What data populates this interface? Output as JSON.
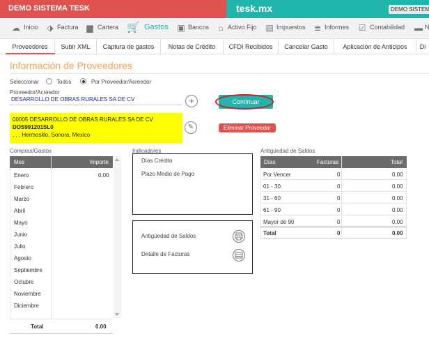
{
  "topbar": {
    "company": "DEMO SISTEMA TESK",
    "brand": "tesk.mx",
    "tag": "DEMO SISTEMA"
  },
  "mainnav": {
    "items": [
      {
        "label": "Inicio",
        "icon": "cloud-icon"
      },
      {
        "label": "Factura",
        "icon": "tag-icon"
      },
      {
        "label": "Cartera",
        "icon": "briefcase-icon"
      },
      {
        "label": "Gastos",
        "icon": "cart-icon"
      },
      {
        "label": "Bancos",
        "icon": "bank-icon"
      },
      {
        "label": "Activo Fijo",
        "icon": "home-icon"
      },
      {
        "label": "Impuestos",
        "icon": "tax-icon"
      },
      {
        "label": "Informes",
        "icon": "report-icon"
      },
      {
        "label": "Contabilidad",
        "icon": "ledger-icon"
      },
      {
        "label": "N",
        "icon": "more-icon"
      }
    ],
    "active_color": "#1fb5ad"
  },
  "subnav": {
    "tabs": [
      "Proveedores",
      "Subir XML",
      "Captura de gastos",
      "Notas de Crédito",
      "CFDI Recibidos",
      "Cancelar Gasto",
      "Aplicación de Anticipos",
      "Di"
    ]
  },
  "page": {
    "title": "Información de Proveedores",
    "select_label": "Seleccionar",
    "radio_todos": "Todos",
    "radio_por": "Por Proveedor/Acreedor",
    "prov_label": "Proveedor/Acreedor",
    "prov_value": "DESARROLLO DE OBRAS RURALES SA DE CV",
    "continuar": "Continuar",
    "eliminar": "Eliminar Proveedor",
    "card": {
      "line1": "00005 DESARROLLO DE OBRAS RURALES SA DE CV",
      "line2": "DOS991201SL0",
      "line3": ", , , Hermosillo, Sonora, Mexico"
    }
  },
  "compras": {
    "section": "Compras/Gastos",
    "col_mes": "Mes",
    "col_importe": "Importe",
    "rows": [
      {
        "mes": "Enero",
        "importe": "0.00"
      },
      {
        "mes": "Febrero",
        "importe": ""
      },
      {
        "mes": "Marzo",
        "importe": ""
      },
      {
        "mes": "Abril",
        "importe": ""
      },
      {
        "mes": "Mayo",
        "importe": ""
      },
      {
        "mes": "Junio",
        "importe": ""
      },
      {
        "mes": "Julio",
        "importe": ""
      },
      {
        "mes": "Agosto",
        "importe": ""
      },
      {
        "mes": "Septiembre",
        "importe": ""
      },
      {
        "mes": "Octubre",
        "importe": ""
      },
      {
        "mes": "Noviembre",
        "importe": ""
      },
      {
        "mes": "Diciembre",
        "importe": ""
      }
    ],
    "total_label": "Total",
    "total_value": "0.00"
  },
  "indicadores": {
    "section": "Indicadores",
    "dias_credito": "Días Crédito",
    "plazo": "Plazo Medio de Pago",
    "antiguedad": "Antigüedad de Saldos",
    "detalle": "Detalle de Facturas"
  },
  "antig": {
    "section": "Antigüedad de Saldos",
    "col_dias": "Días",
    "col_facturas": "Facturas",
    "col_total": "Total",
    "rows": [
      {
        "dias": "Por Vencer",
        "facturas": "0",
        "total": "0.00"
      },
      {
        "dias": "01 - 30",
        "facturas": "0",
        "total": "0.00"
      },
      {
        "dias": "31 - 60",
        "facturas": "0",
        "total": "0.00"
      },
      {
        "dias": "61 - 90",
        "facturas": "0",
        "total": "0.00"
      },
      {
        "dias": "Mayor de 90",
        "facturas": "0",
        "total": "0.00"
      }
    ],
    "total_label": "Total",
    "total_facturas": "0",
    "total_value": "0.00"
  }
}
